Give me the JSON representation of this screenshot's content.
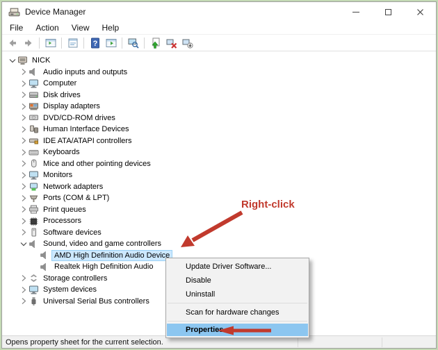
{
  "window": {
    "title": "Device Manager"
  },
  "menu_bar": {
    "items": [
      "File",
      "Action",
      "View",
      "Help"
    ]
  },
  "toolbar": {
    "items": [
      {
        "name": "back-button",
        "icon": "back-icon"
      },
      {
        "name": "forward-button",
        "icon": "forward-icon"
      },
      {
        "type": "separator"
      },
      {
        "name": "show-console-tree-button",
        "icon": "console-tree-icon"
      },
      {
        "type": "separator"
      },
      {
        "name": "properties-toolbar-button",
        "icon": "properties-doc-icon"
      },
      {
        "type": "separator"
      },
      {
        "name": "help-button",
        "icon": "help-icon"
      },
      {
        "name": "action-pane-button",
        "icon": "action-pane-icon"
      },
      {
        "type": "separator"
      },
      {
        "name": "scan-hardware-changes-button",
        "icon": "scan-icon"
      },
      {
        "type": "separator"
      },
      {
        "name": "update-driver-button",
        "icon": "update-driver-icon"
      },
      {
        "name": "disable-device-button",
        "icon": "disable-device-icon"
      },
      {
        "name": "uninstall-device-button",
        "icon": "uninstall-device-icon"
      }
    ]
  },
  "tree": {
    "items": [
      {
        "label": "NICK",
        "level": 0,
        "expand": "expanded",
        "icon": "computer-icon"
      },
      {
        "label": "Audio inputs and outputs",
        "level": 1,
        "expand": "collapsed",
        "icon": "speaker-icon"
      },
      {
        "label": "Computer",
        "level": 1,
        "expand": "collapsed",
        "icon": "monitor-icon"
      },
      {
        "label": "Disk drives",
        "level": 1,
        "expand": "collapsed",
        "icon": "disk-icon"
      },
      {
        "label": "Display adapters",
        "level": 1,
        "expand": "collapsed",
        "icon": "display-card-icon"
      },
      {
        "label": "DVD/CD-ROM drives",
        "level": 1,
        "expand": "collapsed",
        "icon": "disc-drive-icon"
      },
      {
        "label": "Human Interface Devices",
        "level": 1,
        "expand": "collapsed",
        "icon": "hid-icon"
      },
      {
        "label": "IDE ATA/ATAPI controllers",
        "level": 1,
        "expand": "collapsed",
        "icon": "ide-icon"
      },
      {
        "label": "Keyboards",
        "level": 1,
        "expand": "collapsed",
        "icon": "keyboard-icon"
      },
      {
        "label": "Mice and other pointing devices",
        "level": 1,
        "expand": "collapsed",
        "icon": "mouse-icon"
      },
      {
        "label": "Monitors",
        "level": 1,
        "expand": "collapsed",
        "icon": "monitor-icon"
      },
      {
        "label": "Network adapters",
        "level": 1,
        "expand": "collapsed",
        "icon": "network-icon"
      },
      {
        "label": "Ports (COM & LPT)",
        "level": 1,
        "expand": "collapsed",
        "icon": "ports-icon"
      },
      {
        "label": "Print queues",
        "level": 1,
        "expand": "collapsed",
        "icon": "printer-icon"
      },
      {
        "label": "Processors",
        "level": 1,
        "expand": "collapsed",
        "icon": "processor-icon"
      },
      {
        "label": "Software devices",
        "level": 1,
        "expand": "collapsed",
        "icon": "software-icon"
      },
      {
        "label": "Sound, video and game controllers",
        "level": 1,
        "expand": "expanded",
        "icon": "speaker-icon"
      },
      {
        "label": "AMD High Definition Audio Device",
        "level": 2,
        "expand": "none",
        "icon": "speaker-icon",
        "selected": true
      },
      {
        "label": "Realtek High Definition Audio",
        "level": 2,
        "expand": "none",
        "icon": "speaker-icon"
      },
      {
        "label": "Storage controllers",
        "level": 1,
        "expand": "collapsed",
        "icon": "storage-icon"
      },
      {
        "label": "System devices",
        "level": 1,
        "expand": "collapsed",
        "icon": "monitor-icon"
      },
      {
        "label": "Universal Serial Bus controllers",
        "level": 1,
        "expand": "collapsed",
        "icon": "usb-icon"
      }
    ]
  },
  "context_menu": {
    "items": [
      {
        "label": "Update Driver Software...",
        "name": "menu-item-update-driver-software"
      },
      {
        "label": "Disable",
        "name": "menu-item-disable"
      },
      {
        "label": "Uninstall",
        "name": "menu-item-uninstall"
      },
      {
        "type": "separator"
      },
      {
        "label": "Scan for hardware changes",
        "name": "menu-item-scan-for-hardware-changes"
      },
      {
        "type": "separator"
      },
      {
        "label": "Properties",
        "name": "menu-item-properties",
        "highlighted": true
      }
    ]
  },
  "annotation": {
    "label": "Right-click"
  },
  "status_bar": {
    "text": "Opens property sheet for the current selection."
  },
  "colors": {
    "selection": "#cce8ff",
    "menu_highlight": "#8cc6f0",
    "annotation_red": "#c13a2d",
    "border_green": "#c3d9b4",
    "help_blue": "#3f68b4"
  }
}
